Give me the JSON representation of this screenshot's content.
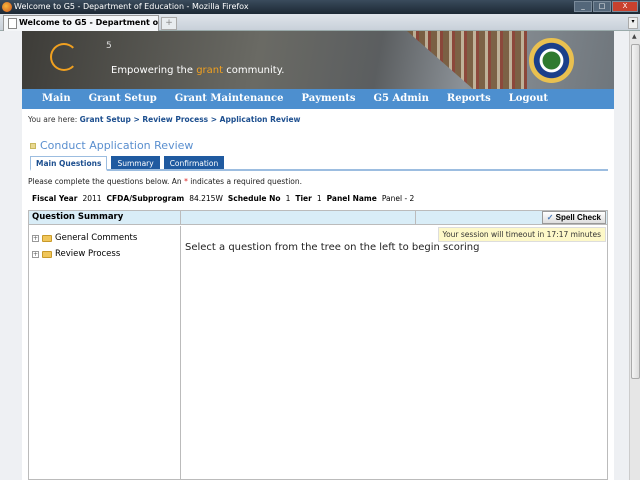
{
  "window": {
    "title": "Welcome to G5 - Department of Education - Mozilla Firefox",
    "tab_label": "Welcome to G5 - Department of Edu...",
    "new_tab": "+",
    "controls": [
      "_",
      "□",
      "X"
    ]
  },
  "banner": {
    "logo_sup": "5",
    "tagline_pre": "Empowering the ",
    "tagline_accent": "grant",
    "tagline_post": " community."
  },
  "nav": {
    "items": [
      "Main",
      "Grant Setup",
      "Grant Maintenance",
      "Payments",
      "G5 Admin",
      "Reports",
      "Logout"
    ]
  },
  "breadcrumb": {
    "prefix": "You are here: ",
    "items": [
      "Grant Setup",
      "Review Process",
      "Application Review"
    ],
    "sep": " > "
  },
  "page": {
    "title": "Conduct Application Review",
    "tabs": [
      "Main Questions",
      "Summary",
      "Confirmation"
    ],
    "active_tab": 0,
    "instructions_pre": "Please complete the questions below. An ",
    "instructions_star": "*",
    "instructions_post": " indicates a required question."
  },
  "meta": {
    "fiscal_year_label": "Fiscal Year",
    "fiscal_year": "2011",
    "cfda_label": "CFDA/Subprogram",
    "cfda": "84.215W",
    "schedule_label": "Schedule No",
    "schedule": "1",
    "tier_label": "Tier",
    "tier": "1",
    "panel_label": "Panel Name",
    "panel": "Panel - 2"
  },
  "questions": {
    "header": "Question Summary",
    "spell_check": "Spell Check",
    "session": "Your session will timeout in 17:17 minutes",
    "prompt": "Select a question from the tree on the left to begin scoring",
    "tree": [
      {
        "label": "General Comments",
        "expand": "+"
      },
      {
        "label": "Review Process",
        "expand": "+"
      }
    ]
  }
}
